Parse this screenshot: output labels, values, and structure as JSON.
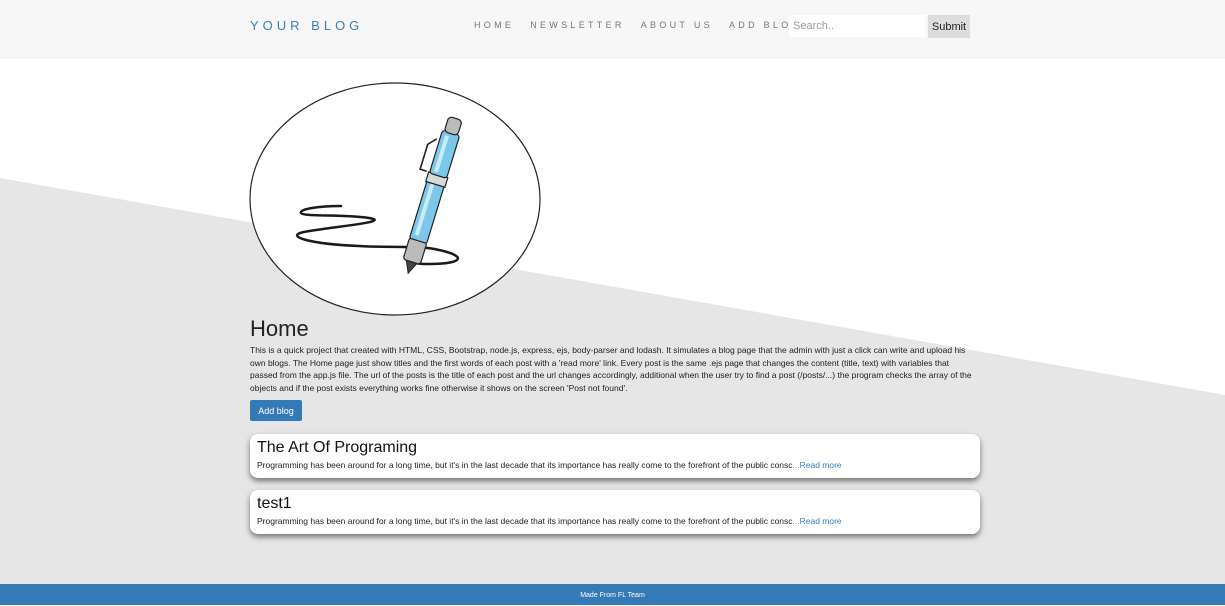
{
  "navbar": {
    "brand": "YOUR BLOG",
    "links": [
      "HOME",
      "NEWSLETTER",
      "ABOUT US",
      "ADD BLOG"
    ],
    "search": {
      "placeholder": "Search..",
      "value": ""
    },
    "submit_label": "Submit"
  },
  "main": {
    "title": "Home",
    "description": "This is a quick project that created with HTML, CSS, Bootstrap, node.js, express, ejs, body-parser and lodash. It simulates a blog page that the admin with just a click can write and upload his own blogs. The Home page just show titles and the first words of each post with a 'read more' link. Every post is the same .ejs page that changes the content (title, text) with variables that passed from the app.js file. The url of the posts is the title of each post and the url changes accordingly, additional when the user try to find a post (/posts/...) the program checks the array of the objects and if the post exists everything works fine otherwise it shows on the screen 'Post not found'.",
    "add_blog_label": "Add blog"
  },
  "posts": [
    {
      "title": "The Art Of Programing",
      "excerpt": "Programming has been around for a long time, but it's in the last decade that its importance has really come to the forefront of the public consc",
      "read_more": "...Read more"
    },
    {
      "title": "test1",
      "excerpt": "Programming has been around for a long time, but it's in the last decade that its importance has really come to the forefront of the public consc",
      "read_more": "...Read more"
    }
  ],
  "footer": {
    "text": "Made From FL Team"
  },
  "icons": {
    "hero": "pen-writing-icon"
  },
  "colors": {
    "accent": "#337ab7",
    "background_band": "#e6e6e6"
  }
}
